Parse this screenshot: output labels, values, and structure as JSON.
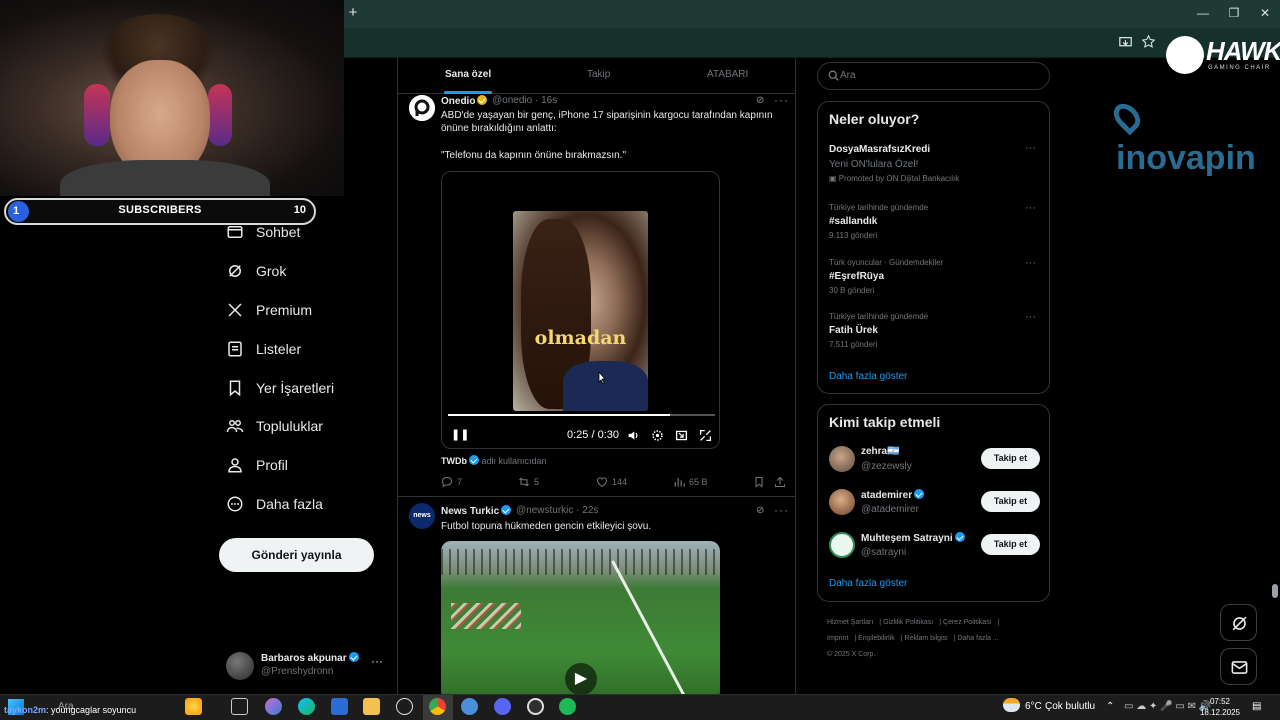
{
  "browser": {
    "new_tab": "+",
    "minimize": "—",
    "restore": "❐",
    "close": "✕"
  },
  "overlay": {
    "subscribers": {
      "current": "1",
      "label": "SUBSCRIBERS",
      "goal": "10"
    },
    "chat": {
      "user": "taykon2m",
      "message": ": youngcaglar soyuncu"
    }
  },
  "sidebar": {
    "items": [
      {
        "label": "Sohbet",
        "icon": "chat-icon"
      },
      {
        "label": "Grok",
        "icon": "grok-icon"
      },
      {
        "label": "Premium",
        "icon": "x-logo-icon"
      },
      {
        "label": "Listeler",
        "icon": "list-icon"
      },
      {
        "label": "Yer İşaretleri",
        "icon": "bookmark-icon"
      },
      {
        "label": "Topluluklar",
        "icon": "communities-icon"
      },
      {
        "label": "Profil",
        "icon": "profile-icon"
      },
      {
        "label": "Daha fazla",
        "icon": "more-circle-icon"
      }
    ],
    "post_button": "Gönderi yayınla",
    "account": {
      "name": "Barbaros akpunar",
      "handle": "@Prenshydronn",
      "more": "···"
    }
  },
  "feed": {
    "tabs": [
      "Sana özel",
      "Takip",
      "ATABARI"
    ],
    "tweets": [
      {
        "name": "Onedio",
        "handle": "@onedio",
        "time": "· 16s",
        "text1": "ABD'de yaşayan bir genç, iPhone 17 siparişinin kargocu tarafından kapının önüne bırakıldığını anlattı:",
        "text2": "\"Telefonu da kapının önüne bırakmazsın.\"",
        "video": {
          "caption": "olmadan",
          "time": "0:25 / 0:30",
          "progress": 0.83
        },
        "source_user": "TWDb",
        "source_text": "adlı kullanıcıdan",
        "replies": "7",
        "reposts": "5",
        "likes": "144",
        "views": "65 B"
      },
      {
        "name": "News Turkic",
        "handle": "@newsturkic",
        "time": "· 22s",
        "text1": "Futbol topuna hükmeden gencin etkileyici şovu.",
        "avatar_text": "news"
      }
    ]
  },
  "right": {
    "search_placeholder": "Ara",
    "trends": {
      "title": "Neler oluyor?",
      "items": [
        {
          "title": "DosyaMasrafsızKredi",
          "sub": "Yeni ON'lulara Özel!",
          "promo": "Promoted by ON Dijital Bankacılık"
        },
        {
          "context": "Türkiye tarihinde gündemde",
          "title": "#sallandık",
          "count": "9.113 gönderi"
        },
        {
          "context": "Türk oyuncular · Gündemdekiler",
          "title": "#EşrefRüya",
          "count": "30 B gönderi"
        },
        {
          "context": "Türkiye tarihinde gündemde",
          "title": "Fatih Ürek",
          "count": "7.511 gönderi"
        }
      ],
      "show_more": "Daha fazla göster"
    },
    "who": {
      "title": "Kimi takip etmeli",
      "items": [
        {
          "name": "zehra🇦🇷",
          "handle": "@zezewsly",
          "button": "Takip et",
          "verified": false
        },
        {
          "name": "atademirer",
          "handle": "@atademirer",
          "button": "Takip et",
          "verified": true
        },
        {
          "name": "Muhteşem Satrayni",
          "handle": "@satrayni",
          "button": "Takip et",
          "verified": true
        }
      ],
      "show_more": "Daha fazla göster"
    },
    "footer": [
      "Hizmet Şartları",
      "Gizlilik Politikası",
      "Çerez Politikası",
      "Imprint",
      "Erişilebilirlik",
      "Reklam bilgisi",
      "Daha fazla ...",
      "© 2025 X Corp."
    ]
  },
  "branding": {
    "hawk": "HAWK",
    "hawk_sub": "GAMING CHAIR",
    "inova": "inovapin"
  },
  "taskbar": {
    "weather_temp": "6°C",
    "weather_text": "Çok bulutlu",
    "time": "07:52",
    "date": "18.12.2025",
    "search_label": "Ara"
  },
  "colors": {
    "accent": "#1d9bf0",
    "background": "#000000",
    "browser_frame": "#1f3a35"
  }
}
